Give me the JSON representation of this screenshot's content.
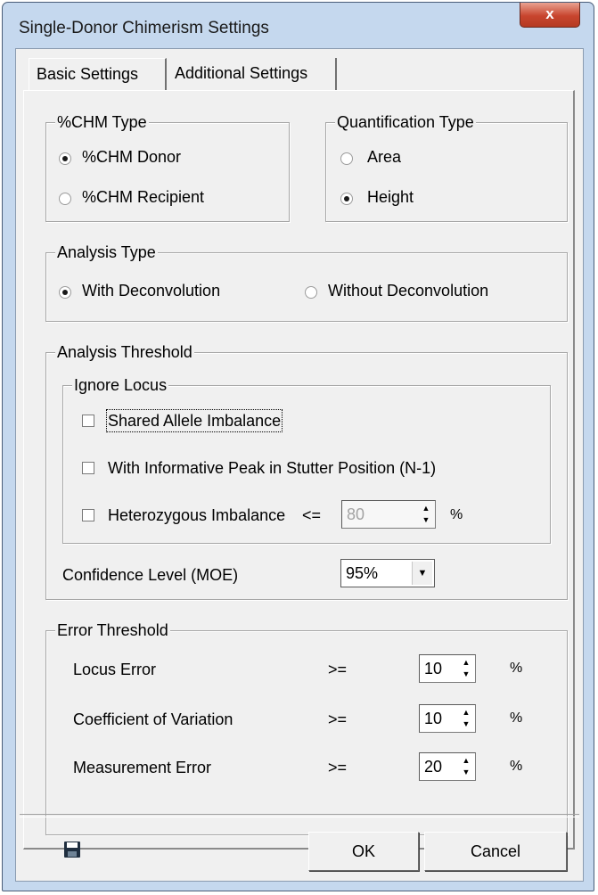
{
  "window": {
    "title": "Single-Donor Chimerism Settings",
    "close_glyph": "x"
  },
  "tabs": [
    "Basic Settings",
    "Additional Settings"
  ],
  "chm_type": {
    "label": "%CHM Type",
    "options": [
      "%CHM Donor",
      "%CHM Recipient"
    ],
    "selected": "%CHM Donor"
  },
  "quantification_type": {
    "label": "Quantification Type",
    "options": [
      "Area",
      "Height"
    ],
    "selected": "Height"
  },
  "analysis_type": {
    "label": "Analysis Type",
    "options": [
      "With Deconvolution",
      "Without Deconvolution"
    ],
    "selected": "With Deconvolution"
  },
  "analysis_threshold": {
    "label": "Analysis Threshold",
    "ignore_locus": {
      "label": "Ignore Locus",
      "shared_allele": "Shared Allele Imbalance",
      "informative_peak": "With Informative Peak in Stutter Position (N-1)",
      "hetero_label": "Heterozygous Imbalance",
      "hetero_op": "<=",
      "hetero_value": "80",
      "hetero_unit": "%"
    },
    "confidence_label": "Confidence Level (MOE)",
    "confidence_value": "95%"
  },
  "error_threshold": {
    "label": "Error Threshold",
    "rows": [
      {
        "label": "Locus Error",
        "op": ">=",
        "value": "10",
        "unit": "%"
      },
      {
        "label": "Coefficient of Variation",
        "op": ">=",
        "value": "10",
        "unit": "%"
      },
      {
        "label": "Measurement Error",
        "op": ">=",
        "value": "20",
        "unit": "%"
      }
    ]
  },
  "buttons": {
    "ok": "OK",
    "cancel": "Cancel"
  },
  "icons": {
    "save": "save-icon",
    "spin": "spin-up-down-icon",
    "dropdown": "chevron-down-icon"
  },
  "colors": {
    "title_bar": "#c5d8ee",
    "close": "#c8452e",
    "client": "#f0f0f0"
  }
}
